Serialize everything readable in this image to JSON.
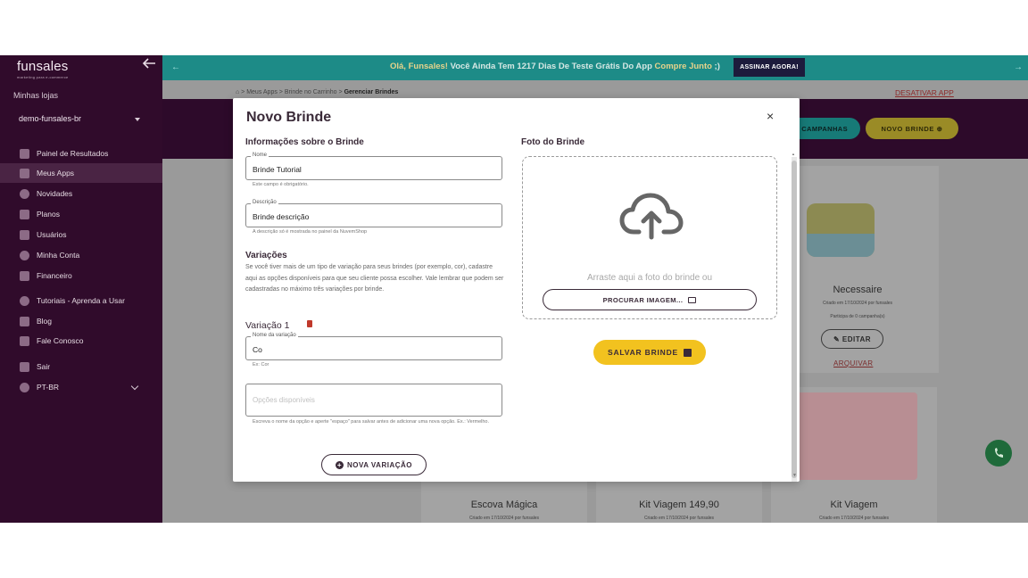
{
  "sidebar": {
    "logo": "funsales",
    "logo_tagline": "marketing para e-commerce",
    "stores_label": "Minhas lojas",
    "store": "demo-funsales-br",
    "items": [
      {
        "label": "Painel de Resultados",
        "icon": "dashboard-icon"
      },
      {
        "label": "Meus Apps",
        "icon": "apps-grid-icon"
      },
      {
        "label": "Novidades",
        "icon": "globe-icon"
      },
      {
        "label": "Planos",
        "icon": "tag-icon"
      },
      {
        "label": "Usuários",
        "icon": "users-icon"
      },
      {
        "label": "Minha Conta",
        "icon": "gear-icon"
      },
      {
        "label": "Financeiro",
        "icon": "money-icon"
      },
      {
        "label": "Tutoriais - Aprenda a Usar",
        "icon": "lightbulb-icon"
      },
      {
        "label": "Blog",
        "icon": "calendar-icon"
      },
      {
        "label": "Fale Conosco",
        "icon": "chat-icon"
      },
      {
        "label": "Sair",
        "icon": "logout-icon"
      },
      {
        "label": "PT-BR",
        "icon": "language-globe-icon"
      }
    ]
  },
  "banner": {
    "greeting": "Olá, Funsales!",
    "message": " Você Ainda Tem 1217 Dias De Teste Grátis Do App ",
    "app_name": "Compre Junto",
    "suffix": " ;)",
    "cta": "ASSINAR AGORA!"
  },
  "page": {
    "breadcrumb_path": " > Meus Apps > Brinde no Carrinho > ",
    "breadcrumb_current": "Gerenciar Brindes",
    "deactivate": "DESATIVAR APP",
    "campaigns_btn": "CAMPANHAS",
    "new_gift_btn": "NOVO BRINDE"
  },
  "cards": [
    {
      "title": "Necessaire",
      "created": "Criado em 17/10/2024 por funsales",
      "participation": "Participa de 0 campanha(s)",
      "edit": "EDITAR",
      "archive": "ARQUIVAR"
    },
    {
      "title": "Escova Mágica",
      "created": "Criado em 17/10/2024 por funsales"
    },
    {
      "title": "Kit Viagem 149,90",
      "created": "Criado em 17/10/2024 por funsales"
    },
    {
      "title": "Kit Viagem",
      "created": "Criado em 17/10/2024 por funsales"
    }
  ],
  "modal": {
    "title": "Novo Brinde",
    "close": "×",
    "info_heading": "Informações sobre o Brinde",
    "name_label": "Nome",
    "name_value": "Brinde Tutorial",
    "name_helper": "Este campo é obrigatório.",
    "desc_label": "Descrição",
    "desc_value": "Brinde descrição",
    "desc_helper": "A descrição só é mostrada no painel da NuvemShop",
    "variations_heading": "Variações",
    "variations_text": "Se você tiver mais de um tipo de variação para seus brindes (por exemplo, cor), cadastre aqui as opções disponíveis para que seu cliente possa escolher. Vale lembrar que podem ser cadastradas no máximo três variações por brinde.",
    "variation_title": "Variação 1",
    "var_name_label": "Nome da variação",
    "var_name_value": "Co",
    "var_name_helper": "Ex: Cor",
    "options_placeholder": "Opções disponíveis",
    "options_helper": "Escreva o nome da opção e aperte \"espaço\" para salvar antes de adicionar uma nova opção. Ex.: Vermelho.",
    "new_variation": "NOVA VARIAÇÃO",
    "photo_heading": "Foto do Brinde",
    "drop_text": "Arraste aqui a foto do brinde ou",
    "browse": "PROCURAR IMAGEM...",
    "save": "SALVAR BRINDE"
  }
}
